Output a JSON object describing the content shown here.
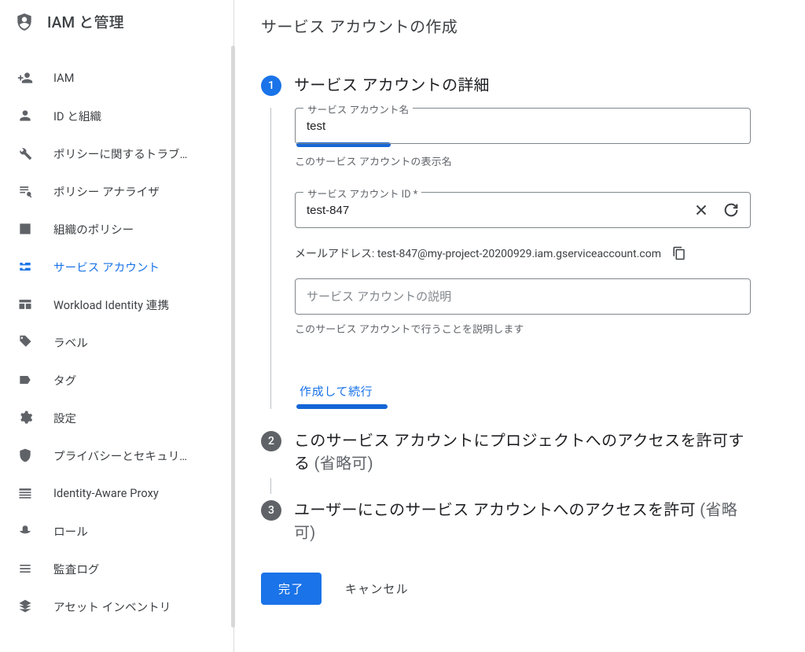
{
  "product": "IAM と管理",
  "nav": [
    {
      "label": "IAM"
    },
    {
      "label": "ID と組織"
    },
    {
      "label": "ポリシーに関するトラブ…"
    },
    {
      "label": "ポリシー アナライザ"
    },
    {
      "label": "組織のポリシー"
    },
    {
      "label": "サービス アカウント",
      "active": true
    },
    {
      "label": "Workload Identity 連携"
    },
    {
      "label": "ラベル"
    },
    {
      "label": "タグ"
    },
    {
      "label": "設定"
    },
    {
      "label": "プライバシーとセキュリ…"
    },
    {
      "label": "Identity-Aware Proxy"
    },
    {
      "label": "ロール"
    },
    {
      "label": "監査ログ"
    },
    {
      "label": "アセット インベントリ"
    }
  ],
  "page_title": "サービス アカウントの作成",
  "steps": {
    "s1": {
      "badge": "1",
      "title": "サービス アカウントの詳細",
      "name_label": "サービス アカウント名",
      "name_value": "test",
      "name_helper": "このサービス アカウントの表示名",
      "id_label": "サービス アカウント ID *",
      "id_value": "test-847",
      "email_prefix": "メールアドレス: ",
      "email_value": "test-847@my-project-20200929.iam.gserviceaccount.com",
      "desc_placeholder": "サービス アカウントの説明",
      "desc_helper": "このサービス アカウントで行うことを説明します",
      "continue": "作成して続行"
    },
    "s2": {
      "badge": "2",
      "title_a": "このサービス アカウントにプロジェクトへのアクセスを許可する ",
      "title_opt": "(省略可)"
    },
    "s3": {
      "badge": "3",
      "title_a": "ユーザーにこのサービス アカウントへのアクセスを許可 ",
      "title_opt": "(省略可)"
    }
  },
  "actions": {
    "done": "完了",
    "cancel": "キャンセル"
  }
}
